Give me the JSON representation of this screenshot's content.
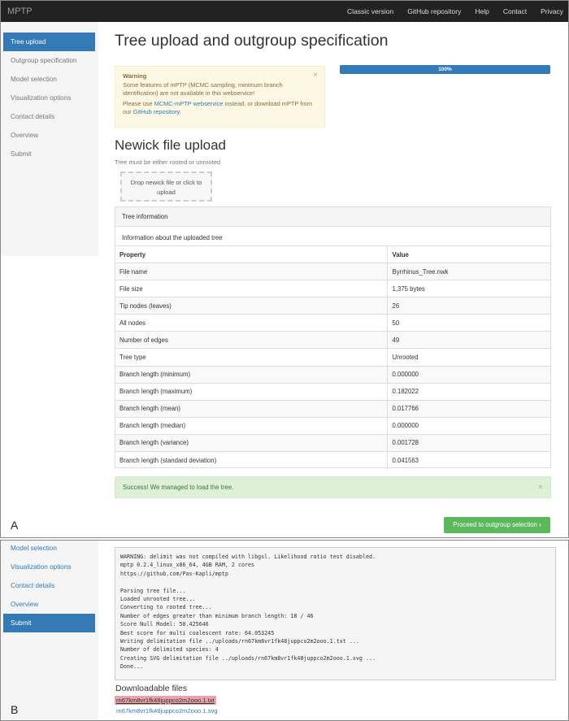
{
  "panel_a": {
    "label": "A",
    "navbar": {
      "brand": "MPTP",
      "links": [
        "Classic version",
        "GitHub repository",
        "Help",
        "Contact",
        "Privacy"
      ]
    },
    "sidebar": {
      "items": [
        {
          "label": "Tree upload",
          "active": true
        },
        {
          "label": "Outgroup specification",
          "active": false
        },
        {
          "label": "Model selection",
          "active": false
        },
        {
          "label": "Visualization options",
          "active": false
        },
        {
          "label": "Contact details",
          "active": false
        },
        {
          "label": "Overview",
          "active": false
        },
        {
          "label": "Submit",
          "active": false
        }
      ]
    },
    "page_title": "Tree upload and outgroup specification",
    "warning": {
      "title": "Warning",
      "line1": "Some features of mPTP (MCMC sampling, minimum branch identification) are not available in this webservice!",
      "line2_prefix": "Please use ",
      "line2_link1": "MCMC-mPTP webservice",
      "line2_mid": " instead, or download mPTP from our ",
      "line2_link2": "GitHub repository",
      "line2_suffix": ".",
      "close": "×"
    },
    "progress": {
      "value": 1.0,
      "label": "100%"
    },
    "section_title": "Newick file upload",
    "help_text": "Tree must be either rooted or unrooted",
    "dropzone_text": "Drop newick file or click to upload",
    "tree_info": {
      "heading": "Tree information",
      "subheading": "Information about the uploaded tree",
      "columns": [
        "Property",
        "Value"
      ],
      "rows": [
        [
          "File name",
          "Byrrhinus_Tree.nwk"
        ],
        [
          "File size",
          "1,375 bytes"
        ],
        [
          "Tip nodes (leaves)",
          "26"
        ],
        [
          "All nodes",
          "50"
        ],
        [
          "Number of edges",
          "49"
        ],
        [
          "Tree type",
          "Unrooted"
        ],
        [
          "Branch length (minimum)",
          "0.000000"
        ],
        [
          "Branch length (maximum)",
          "0.182022"
        ],
        [
          "Branch length (mean)",
          "0.017766"
        ],
        [
          "Branch length (median)",
          "0.000000"
        ],
        [
          "Branch length (variance)",
          "0.001728"
        ],
        [
          "Branch length (standard deviation)",
          "0.041563"
        ]
      ]
    },
    "success": {
      "text": "Success! We managed to load the tree.",
      "close": "×"
    },
    "proceed_button": "Proceed to outgroup selection",
    "proceed_icon": "›"
  },
  "panel_b": {
    "label": "B",
    "sidebar": {
      "items": [
        {
          "label": "Model selection",
          "active": false
        },
        {
          "label": "Visualization options",
          "active": false
        },
        {
          "label": "Contact details",
          "active": false
        },
        {
          "label": "Overview",
          "active": false
        },
        {
          "label": "Submit",
          "active": true
        }
      ]
    },
    "console_lines": [
      "WARNING: delimit was not compiled with libgsl. Likelihood ratio test disabled.",
      "mptp 0.2.4_linux_x86_64, 4GB RAM, 2 cores",
      "https://github.com/Pas-Kapli/mptp",
      "",
      "Parsing tree file...",
      "Loaded unrooted tree...",
      "Converting to rooted tree...",
      "Number of edges greater than minimum branch length: 18 / 46",
      "Score Null Model: 50.425646",
      "Best score for multi coalescent rate: 64.053245",
      "Writing delimitation file ../uploads/rn67km8vr1fk48juppco2m2ooo.1.txt ...",
      "Number of delimited species: 4",
      "Creating SVG delimitation file ../uploads/rn67km8vr1fk48juppco2m2ooo.1.svg ...",
      "Done..."
    ],
    "downloads_title": "Downloadable files",
    "files": [
      "rn67km8vr1fk48juppco2m2ooo.1.txt",
      "rn67km8vr1fk48juppco2m2ooo.1.svg"
    ]
  },
  "colors": {
    "primary": "#337ab7",
    "navbar": "#222222",
    "warning_bg": "#fcf8e3",
    "success_bg": "#dff0d8",
    "button_green": "#5cb85c",
    "highlight": "#e9a3a9"
  }
}
